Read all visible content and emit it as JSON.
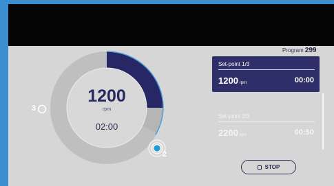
{
  "program": {
    "label": "Program",
    "number": "299"
  },
  "dial": {
    "speed": "1200",
    "unit": "rpm",
    "time": "02:00",
    "markers": [
      "2",
      "3"
    ],
    "progress_fraction": 0.36
  },
  "setpoints": [
    {
      "title": "Set-point 1/3",
      "speed": "1200",
      "unit": "rpm",
      "time": "00:00",
      "active": true
    },
    {
      "title": "Set-point 2/3",
      "speed": "2200",
      "unit": "rpm",
      "time": "00:50",
      "active": false
    }
  ],
  "stop_button": {
    "label": "STOP",
    "icon": "stop-icon"
  },
  "colors": {
    "accent": "#2e2f68",
    "highlight": "#2196d3",
    "background": "#d6d6d6"
  }
}
